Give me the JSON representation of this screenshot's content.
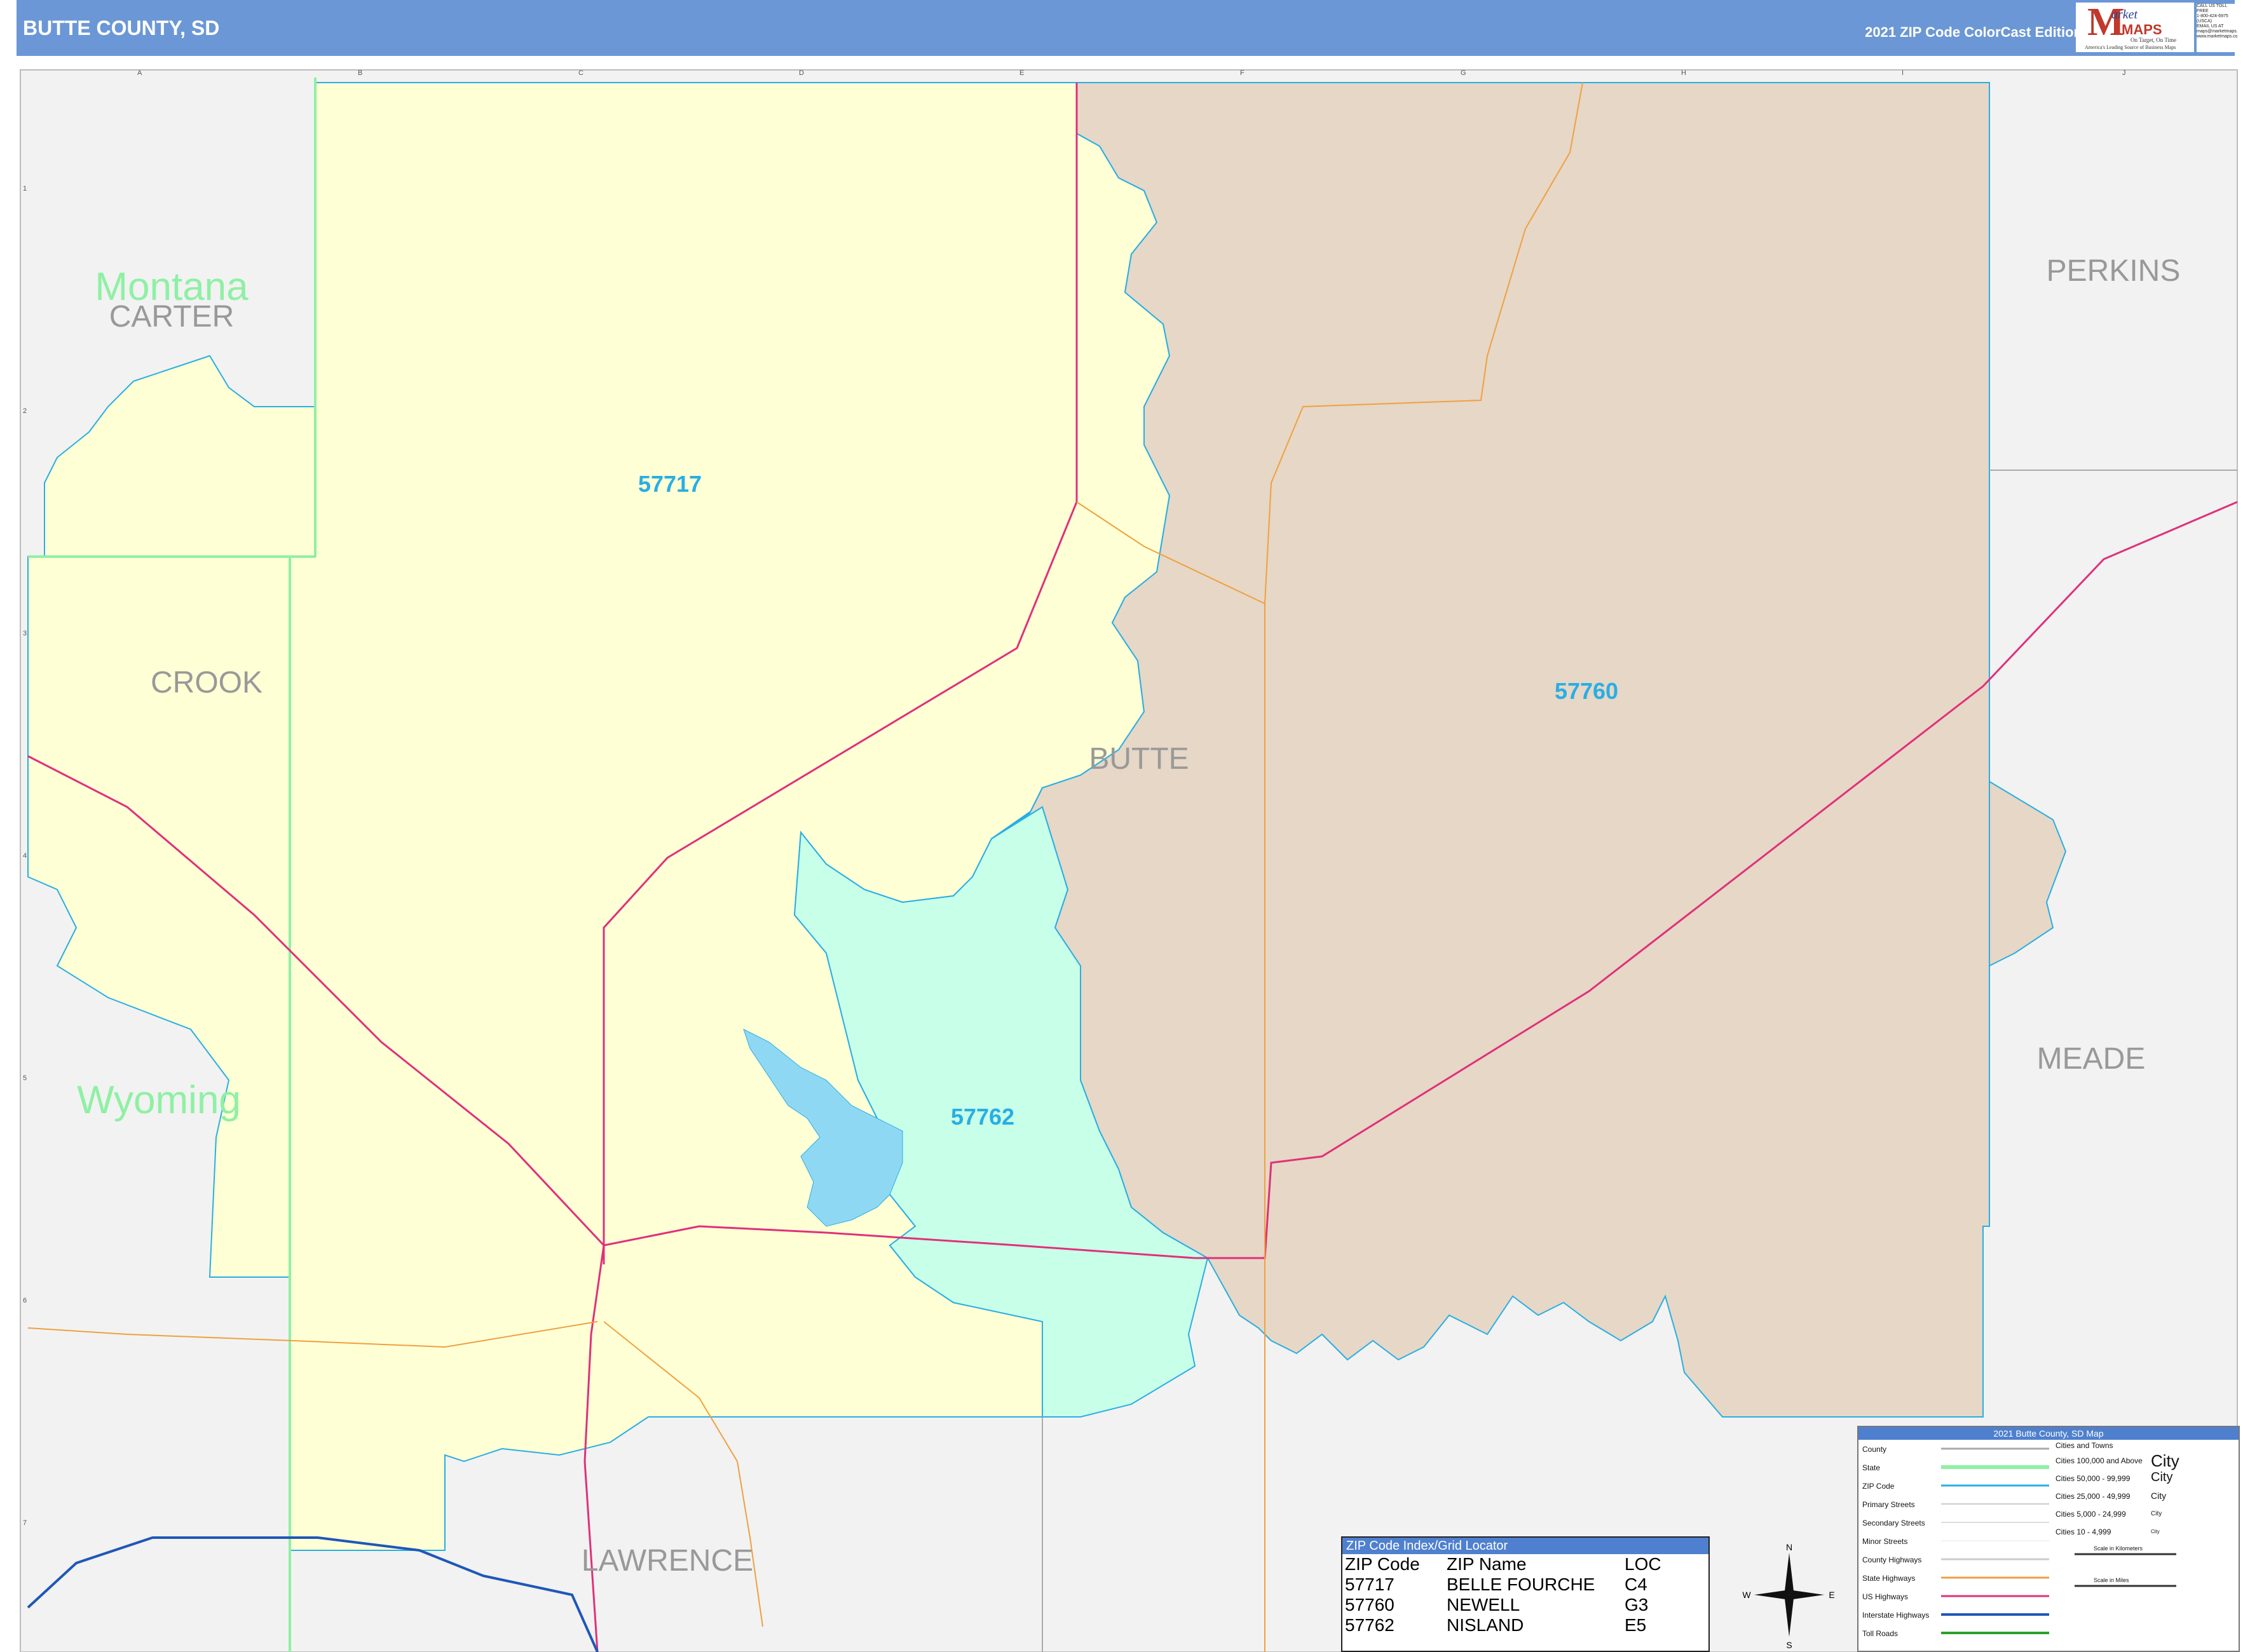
{
  "header": {
    "title": "BUTTE COUNTY, SD",
    "edition": "2021 ZIP Code ColorCast Edition"
  },
  "logo": {
    "letter": "M",
    "line1": "arket",
    "line2": "MAPS",
    "tagline": "On Target, On Time",
    "sub": "America's Leading Source of Business Maps"
  },
  "contact": {
    "lines": [
      "CALL US TOLL FREE",
      "1-800-424-6975 (USCA)",
      "EMAIL US AT",
      "maps@marketmaps.com",
      "www.marketmaps.com"
    ]
  },
  "colors": {
    "zip_57717": "#ffffd6",
    "zip_57760": "#e6d7c6",
    "zip_57762": "#c8ffe8",
    "outside": "#f2f2f2",
    "zip_boundary": "#29aee3",
    "state_line": "#8ff0a4",
    "us_highway": "#e0307a",
    "state_highway": "#f0a040",
    "interstate": "#1f57b8",
    "water": "#8fd8f4"
  },
  "grid": {
    "columns": [
      "A",
      "B",
      "C",
      "D",
      "E",
      "F",
      "G",
      "H",
      "I",
      "J"
    ],
    "rows": [
      "1",
      "2",
      "3",
      "4",
      "5",
      "6",
      "7"
    ]
  },
  "map": {
    "states": [
      "Montana",
      "Wyoming"
    ],
    "counties": [
      "CARTER",
      "CROOK",
      "BUTTE",
      "PERKINS",
      "MEADE",
      "LAWRENCE"
    ],
    "zip_labels": [
      "57717",
      "57760",
      "57762"
    ]
  },
  "zip_index": {
    "title": "ZIP Code Index/Grid Locator",
    "headers": [
      "ZIP Code",
      "ZIP Name",
      "LOC"
    ],
    "rows": [
      [
        "57717",
        "BELLE FOURCHE",
        "C4"
      ],
      [
        "57760",
        "NEWELL",
        "G3"
      ],
      [
        "57762",
        "NISLAND",
        "E5"
      ]
    ]
  },
  "legend": {
    "title": "2021 Butte County, SD Map",
    "items": [
      "County",
      "State",
      "ZIP Code",
      "Primary Streets",
      "Secondary Streets",
      "Minor Streets",
      "County Highways",
      "State Highways",
      "US Highways",
      "Interstate Highways",
      "Toll Roads"
    ],
    "cities_title": "Cities and Towns",
    "cities": [
      {
        "range": "Cities 100,000 and Above",
        "label": "City"
      },
      {
        "range": "Cities 50,000 - 99,999",
        "label": "City"
      },
      {
        "range": "Cities 25,000 - 49,999",
        "label": "City"
      },
      {
        "range": "Cities 5,000 - 24,999",
        "label": "City"
      },
      {
        "range": "Cities 10 - 4,999",
        "label": "City"
      }
    ],
    "scale_km": "Scale in Kilometers",
    "scale_mi": "Scale in Miles"
  },
  "compass": {
    "n": "N",
    "s": "S",
    "e": "E",
    "w": "W"
  }
}
